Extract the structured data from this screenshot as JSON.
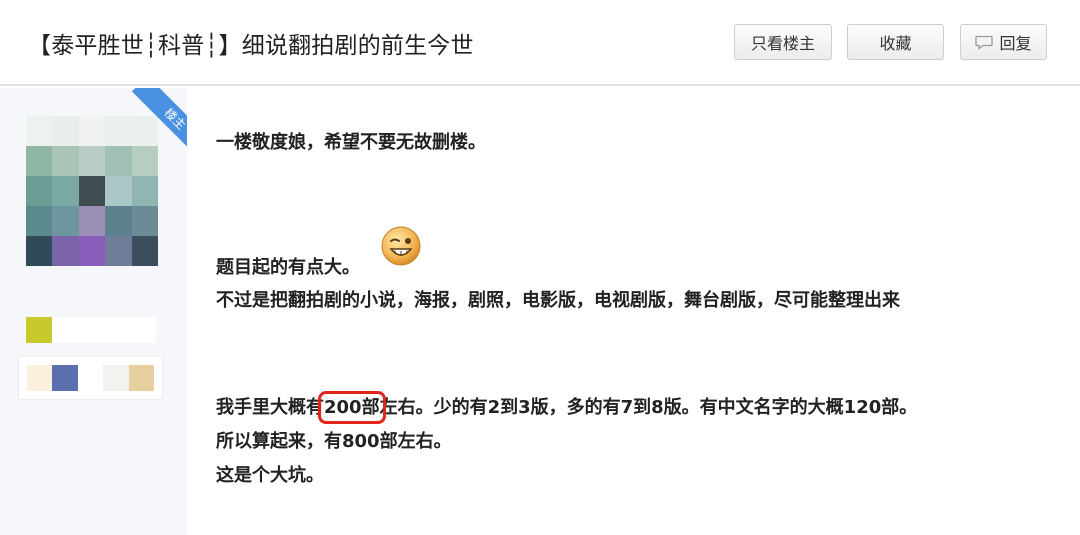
{
  "header": {
    "title": "【泰平胜世┆科普┆】细说翻拍剧的前生今世",
    "buttons": {
      "only_owner": "只看楼主",
      "favorite": "收藏",
      "reply": "回复"
    }
  },
  "author": {
    "badge": "楼主"
  },
  "post": {
    "line1": "一楼敬度娘，希望不要无故删楼。",
    "line2": "题目起的有点大。",
    "line3": "不过是把翻拍剧的小说，海报，剧照，电影版，电视剧版，舞台剧版，尽可能整理出来",
    "line4_pre": "我手里大概有",
    "line4_highlight": "200部",
    "line4_post": "左右。少的有2到3版，多的有7到8版。有中文名字的大概120部。",
    "line5": "所以算起来，有800部左右。",
    "line6": "这是个大坑。",
    "emoji_icon": "wink-smiley-icon"
  },
  "colors": {
    "ribbon": "#4a90e2",
    "highlight": "#e0251b",
    "sidebar_bg": "#f5f7fa"
  }
}
